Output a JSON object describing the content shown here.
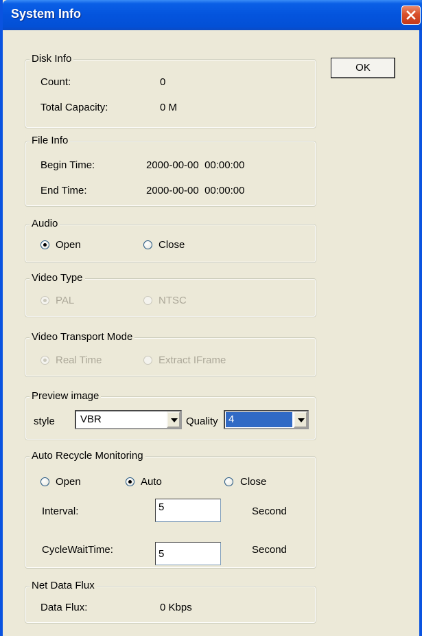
{
  "window": {
    "title": "System Info"
  },
  "ok_button": "OK",
  "disk_info": {
    "legend": "Disk Info",
    "count_label": "Count:",
    "count_value": "0",
    "capacity_label": "Total Capacity:",
    "capacity_value": "0 M"
  },
  "file_info": {
    "legend": "File Info",
    "begin_label": "Begin Time:",
    "begin_value": "2000-00-00  00:00:00",
    "end_label": "End Time:",
    "end_value": "2000-00-00  00:00:00"
  },
  "audio": {
    "legend": "Audio",
    "options": [
      {
        "label": "Open",
        "checked": true
      },
      {
        "label": "Close",
        "checked": false
      }
    ]
  },
  "video_type": {
    "legend": "Video Type",
    "options": [
      {
        "label": "PAL",
        "checked": true
      },
      {
        "label": "NTSC",
        "checked": false
      }
    ],
    "enabled": false
  },
  "video_transport": {
    "legend": "Video Transport Mode",
    "options": [
      {
        "label": "Real Time",
        "checked": true
      },
      {
        "label": "Extract IFrame",
        "checked": false
      }
    ],
    "enabled": false
  },
  "preview_image": {
    "legend": "Preview image",
    "style_label": "style",
    "style_value": "VBR",
    "quality_label": "Quality",
    "quality_value": "4"
  },
  "auto_recycle": {
    "legend": "Auto Recycle Monitoring",
    "options": [
      {
        "label": "Open",
        "checked": false
      },
      {
        "label": "Auto",
        "checked": true
      },
      {
        "label": "Close",
        "checked": false
      }
    ],
    "interval_label": "Interval:",
    "interval_value": "5",
    "interval_unit": "Second",
    "cyclewait_label": "CycleWaitTime:",
    "cyclewait_value": "5",
    "cyclewait_unit": "Second"
  },
  "net_data_flux": {
    "legend": "Net Data Flux",
    "flux_label": "Data Flux:",
    "flux_value": "0 Kbps"
  },
  "colors": {
    "title_bar": "#0454dd",
    "dialog_bg": "#ece9d8",
    "selection": "#316ac5",
    "close_button": "#d9502b"
  }
}
